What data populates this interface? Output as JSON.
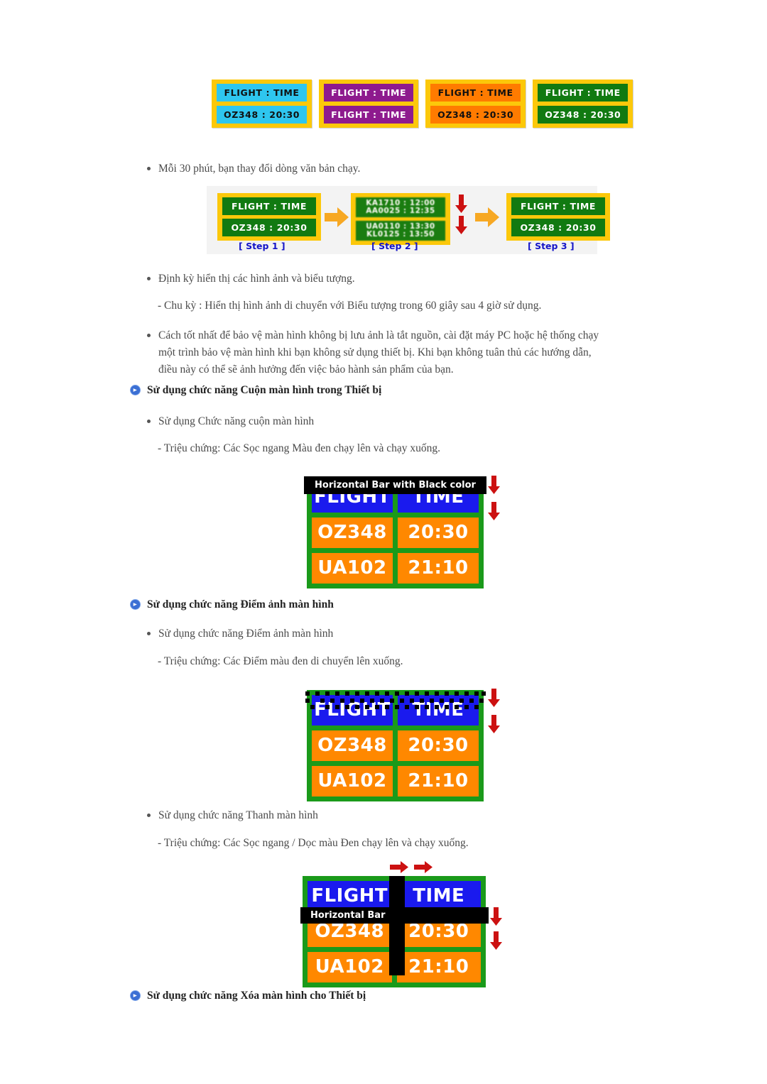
{
  "document": {
    "language": "vi",
    "theme_colors": {
      "board_frame_yellow": "#fcc80a",
      "board_green": "#1a9a1a",
      "header_blue": "#1a1aee",
      "data_orange": "#ff8800",
      "arrow_red": "#cc1111",
      "arrow_orange": "#f7a823",
      "step_label_blue": "#1414c8",
      "heading_icon_blue": "#3b6fd4",
      "body_text": "#4a4a4a"
    }
  },
  "top_boards": {
    "name": "color-variation-boards",
    "items": [
      {
        "variant": "cyan",
        "bg": "#2ec6ef",
        "fg": "#101010",
        "row1": "FLIGHT : TIME",
        "row2": "OZ348   : 20:30"
      },
      {
        "variant": "purple",
        "bg": "#8e1a8e",
        "fg": "#ffffff",
        "row1": "FLIGHT : TIME",
        "row2": "FLIGHT : TIME"
      },
      {
        "variant": "orange",
        "bg": "#ff7b00",
        "fg": "#101010",
        "row1": "FLIGHT : TIME",
        "row2": "OZ348   : 20:30"
      },
      {
        "variant": "green",
        "bg": "#117a11",
        "fg": "#ffffff",
        "row1": "FLIGHT : TIME",
        "row2": "OZ348   : 20:30"
      }
    ]
  },
  "bullets": {
    "change_text_every_30min": "Mỗi 30 phút, bạn thay đổi dòng văn bản chạy.",
    "periodic_display": "Định kỳ hiển thị các hình ảnh và biểu tượng.",
    "periodic_cycle": "- Chu kỳ : Hiển thị hình ảnh di chuyển với Biểu tượng trong 60 giây sau 4 giờ sử dụng.",
    "best_practice": "Cách tốt nhất để bảo vệ màn hình không bị lưu ảnh là tắt nguồn, cài đặt máy PC hoặc hệ thống chạy một trình bảo vệ màn hình khi bạn không sử dụng thiết bị. Khi bạn không tuân thủ các hướng dẫn, điều này có thể sẽ ảnh hưởng đến việc bảo hành sản phẩm của bạn."
  },
  "step_diagram": {
    "name": "screen-scroll-steps",
    "step1": {
      "label": "[ Step 1 ]",
      "row1": "FLIGHT : TIME",
      "row2": "OZ348   : 20:30"
    },
    "step2": {
      "label": "[ Step 2 ]",
      "block1_line1": "KA1710 : 12:00",
      "block1_line2": "AA0025 : 12:35",
      "block2_line1": "UA0110 : 13:30",
      "block2_line2": "KL0125 : 13:50"
    },
    "step3": {
      "label": "[ Step 3 ]",
      "row1": "FLIGHT : TIME",
      "row2": "OZ348   : 20:30"
    }
  },
  "section_scroll": {
    "heading": "Sử dụng chức năng Cuộn màn hình trong Thiết bị",
    "bullet": "Sử dụng Chức năng cuộn màn hình",
    "symptom": "- Triệu chứng: Các Sọc ngang Màu đen chạy lên và chạy xuống.",
    "board": {
      "bar_label": "Horizontal Bar with Black color",
      "header": [
        "FLIGHT",
        "TIME"
      ],
      "rows": [
        [
          "OZ348",
          "20:30"
        ],
        [
          "UA102",
          "21:10"
        ]
      ]
    }
  },
  "section_pixel": {
    "heading": "Sử dụng chức năng Điểm ảnh màn hình",
    "bullet": "Sử dụng chức năng Điểm ảnh màn hình",
    "symptom": "- Triệu chứng: Các Điểm màu đen di chuyển lên xuống.",
    "board": {
      "header": [
        "FLIGHT",
        "TIME"
      ],
      "rows": [
        [
          "OZ348",
          "20:30"
        ],
        [
          "UA102",
          "21:10"
        ]
      ]
    }
  },
  "section_bar": {
    "bullet": "Sử dụng chức năng Thanh màn hình",
    "symptom": "- Triệu chứng: Các Sọc ngang / Dọc màu Đen chạy lên và chạy xuống.",
    "board": {
      "bar_label": "Horizontal Bar",
      "header": [
        "FLIGHT",
        "TIME"
      ],
      "rows": [
        [
          "OZ348",
          "20:30"
        ],
        [
          "UA102",
          "21:10"
        ]
      ]
    }
  },
  "section_eraser": {
    "heading": "Sử dụng chức năng Xóa màn hình cho Thiết bị"
  }
}
